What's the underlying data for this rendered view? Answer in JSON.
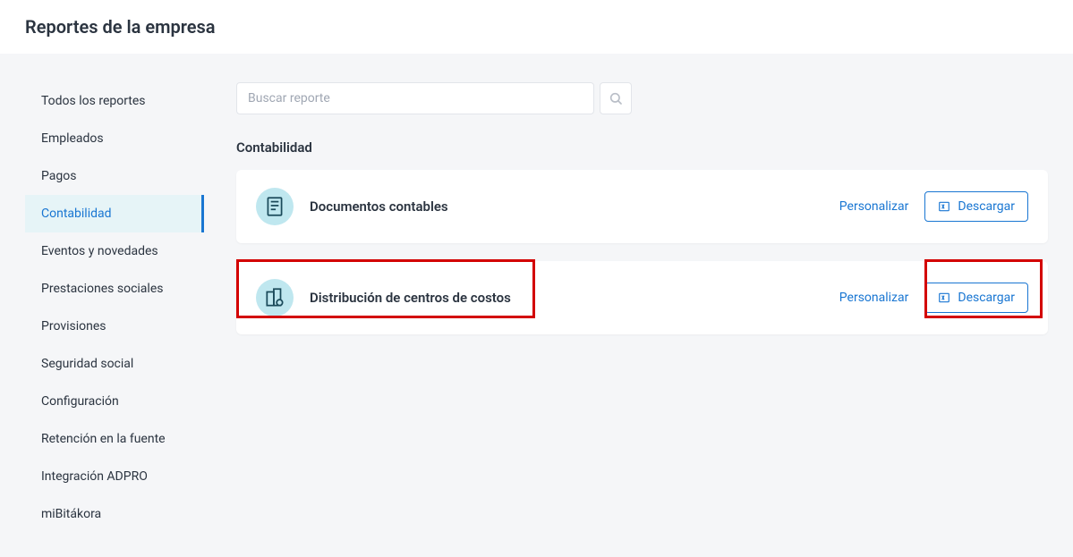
{
  "header": {
    "title": "Reportes de la empresa"
  },
  "sidebar": {
    "items": [
      {
        "label": "Todos los reportes",
        "active": false
      },
      {
        "label": "Empleados",
        "active": false
      },
      {
        "label": "Pagos",
        "active": false
      },
      {
        "label": "Contabilidad",
        "active": true
      },
      {
        "label": "Eventos y novedades",
        "active": false
      },
      {
        "label": "Prestaciones sociales",
        "active": false
      },
      {
        "label": "Provisiones",
        "active": false
      },
      {
        "label": "Seguridad social",
        "active": false
      },
      {
        "label": "Configuración",
        "active": false
      },
      {
        "label": "Retención en la fuente",
        "active": false
      },
      {
        "label": "Integración ADPRO",
        "active": false
      },
      {
        "label": "miBitákora",
        "active": false
      }
    ]
  },
  "search": {
    "placeholder": "Buscar reporte"
  },
  "section": {
    "title": "Contabilidad"
  },
  "reports": [
    {
      "title": "Documentos contables",
      "personalize": "Personalizar",
      "download": "Descargar"
    },
    {
      "title": "Distribución de centros de costos",
      "personalize": "Personalizar",
      "download": "Descargar"
    }
  ]
}
